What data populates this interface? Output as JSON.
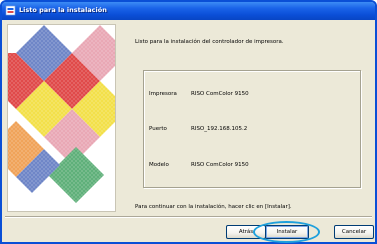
{
  "window": {
    "title": "Listo para la instalación"
  },
  "main": {
    "heading": "Listo para la instalación del controlador de impresora.",
    "rows": [
      {
        "label": "Impresora",
        "value": "RISO ComColor 9150"
      },
      {
        "label": "Puerto",
        "value": "RISO_192.168.105.2"
      },
      {
        "label": "Modelo",
        "value": "RISO ComColor 9150"
      }
    ],
    "footer": "Para continuar con la instalación, hacer clic en [Instalar]."
  },
  "buttons": {
    "back": "Atrás",
    "install": "Instalar",
    "cancel": "Cancelar"
  },
  "colors": {
    "titlebar": "#0b4fd8",
    "highlight": "#1ea0dc",
    "art_red": "#e04a4a",
    "art_yellow": "#f3e04a",
    "art_blue": "#6f86c7",
    "art_green": "#5fb07a",
    "art_orange": "#f0a35a",
    "art_pink": "#e9a8b5"
  }
}
